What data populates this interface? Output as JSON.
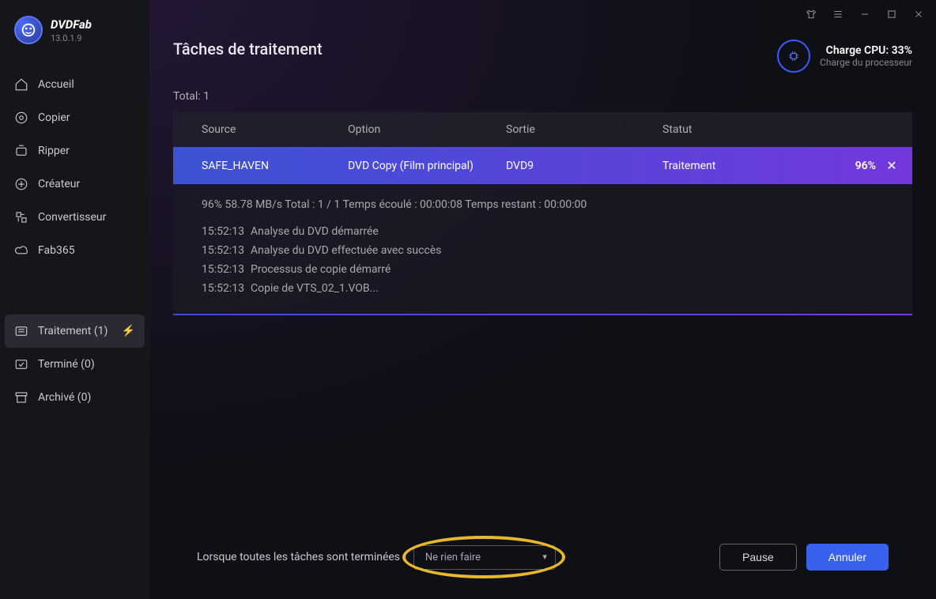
{
  "brand": {
    "name": "DVDFab",
    "version": "13.0.1.9"
  },
  "sidebar": {
    "items": [
      {
        "label": "Accueil"
      },
      {
        "label": "Copier"
      },
      {
        "label": "Ripper"
      },
      {
        "label": "Créateur"
      },
      {
        "label": "Convertisseur"
      },
      {
        "label": "Fab365"
      }
    ],
    "items2": [
      {
        "label": "Traitement (1)"
      },
      {
        "label": "Terminé (0)"
      },
      {
        "label": "Archivé (0)"
      }
    ]
  },
  "header": {
    "title": "Tâches de traitement",
    "total": "Total: 1",
    "cpu_label": "Charge CPU: 33%",
    "cpu_sub": "Charge du processeur"
  },
  "table": {
    "headers": {
      "source": "Source",
      "option": "Option",
      "output": "Sortie",
      "status": "Statut"
    },
    "row": {
      "source": "SAFE_HAVEN",
      "option": "DVD Copy (Film principal)",
      "output": "DVD9",
      "status": "Traitement",
      "percent": "96%"
    }
  },
  "details": {
    "stats": "96%  58.78 MB/s   Total : 1 / 1  Temps écoulé : 00:00:08  Temps restant : 00:00:00",
    "log": [
      {
        "ts": "15:52:13",
        "msg": "Analyse du DVD démarrée"
      },
      {
        "ts": "15:52:13",
        "msg": "Analyse du DVD effectuée avec succès"
      },
      {
        "ts": "15:52:13",
        "msg": "Processus de copie démarré"
      },
      {
        "ts": "15:52:13",
        "msg": "Copie de VTS_02_1.VOB..."
      }
    ]
  },
  "footer": {
    "label": "Lorsque toutes les tâches sont terminées :",
    "dropdown": "Ne rien faire",
    "pause": "Pause",
    "cancel": "Annuler"
  }
}
